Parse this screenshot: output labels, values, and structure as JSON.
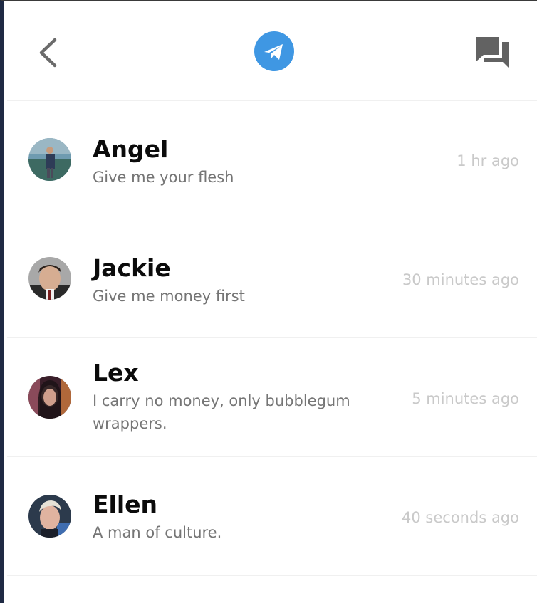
{
  "header": {
    "back_icon": "chevron-left-icon",
    "logo_icon": "telegram-paper-plane-icon",
    "chat_icon": "forum-chat-icon",
    "logo_color": "#3f97e3"
  },
  "conversations": [
    {
      "name": "Angel",
      "message": "Give me your flesh",
      "time": "1 hr ago"
    },
    {
      "name": "Jackie",
      "message": "Give me money first",
      "time": "30 minutes ago"
    },
    {
      "name": "Lex",
      "message": "I carry no money, only bubblegum wrappers.",
      "time": "5 minutes ago"
    },
    {
      "name": "Ellen",
      "message": "A man of culture.",
      "time": "40 seconds ago"
    }
  ]
}
